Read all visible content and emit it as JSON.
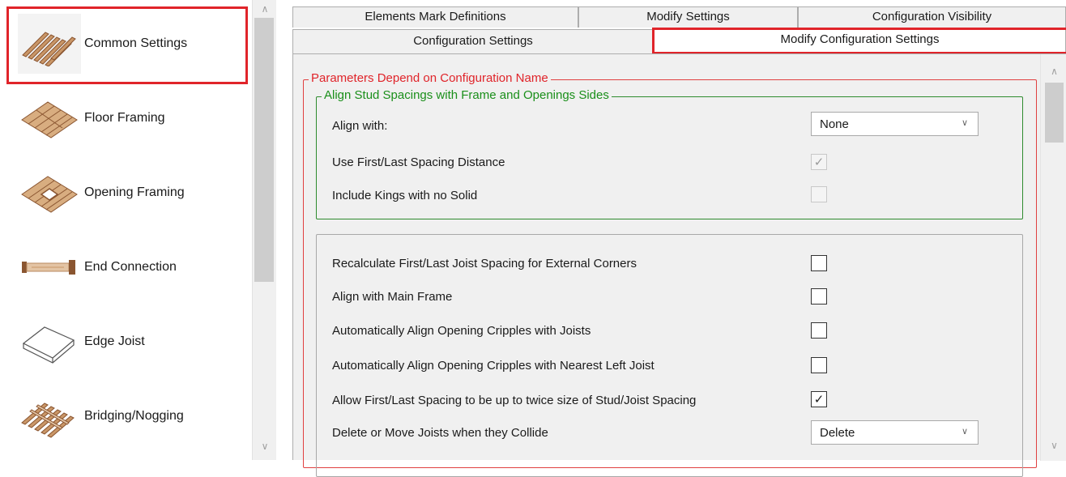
{
  "sidebar": {
    "items": [
      {
        "label": "Common Settings",
        "icon": "joists-icon",
        "selected": true
      },
      {
        "label": "Floor Framing",
        "icon": "floor-framing-icon"
      },
      {
        "label": "Opening Framing",
        "icon": "opening-framing-icon"
      },
      {
        "label": "End Connection",
        "icon": "end-connection-icon"
      },
      {
        "label": "Edge Joist",
        "icon": "edge-joist-icon"
      },
      {
        "label": "Bridging/Nogging",
        "icon": "bridging-icon"
      }
    ]
  },
  "tabs": {
    "row1": [
      {
        "label": "Elements Mark Definitions"
      },
      {
        "label": "Modify Settings"
      },
      {
        "label": "Configuration Visibility"
      }
    ],
    "row2": [
      {
        "label": "Configuration Settings"
      },
      {
        "label": "Modify Configuration Settings",
        "active": true
      }
    ]
  },
  "groups": {
    "params_title": "Parameters Depend on Configuration Name",
    "align_title": "Align Stud Spacings with Frame and Openings Sides"
  },
  "align": {
    "align_with_label": "Align with:",
    "align_with_value": "None",
    "use_first_last_label": "Use First/Last Spacing Distance",
    "use_first_last_checked": true,
    "include_kings_label": "Include Kings with no Solid",
    "include_kings_checked": false
  },
  "options": [
    {
      "label": "Recalculate First/Last Joist Spacing for External Corners",
      "checked": false
    },
    {
      "label": "Align with Main Frame",
      "checked": false
    },
    {
      "label": "Automatically Align Opening Cripples with Joists",
      "checked": false
    },
    {
      "label": "Automatically Align Opening Cripples with Nearest Left Joist",
      "checked": false
    },
    {
      "label": "Allow First/Last Spacing to be up to twice size of Stud/Joist Spacing",
      "checked": true
    }
  ],
  "collide": {
    "label": "Delete or Move Joists when they Collide",
    "value": "Delete"
  },
  "glyphs": {
    "check": "✓",
    "chevron_down": "∨",
    "arrow_up": "∧",
    "arrow_down": "∨"
  },
  "colors": {
    "highlight": "#e0242a",
    "group_red": "#e04040",
    "group_green": "#2e8b2e",
    "wood": "#a0683a"
  }
}
